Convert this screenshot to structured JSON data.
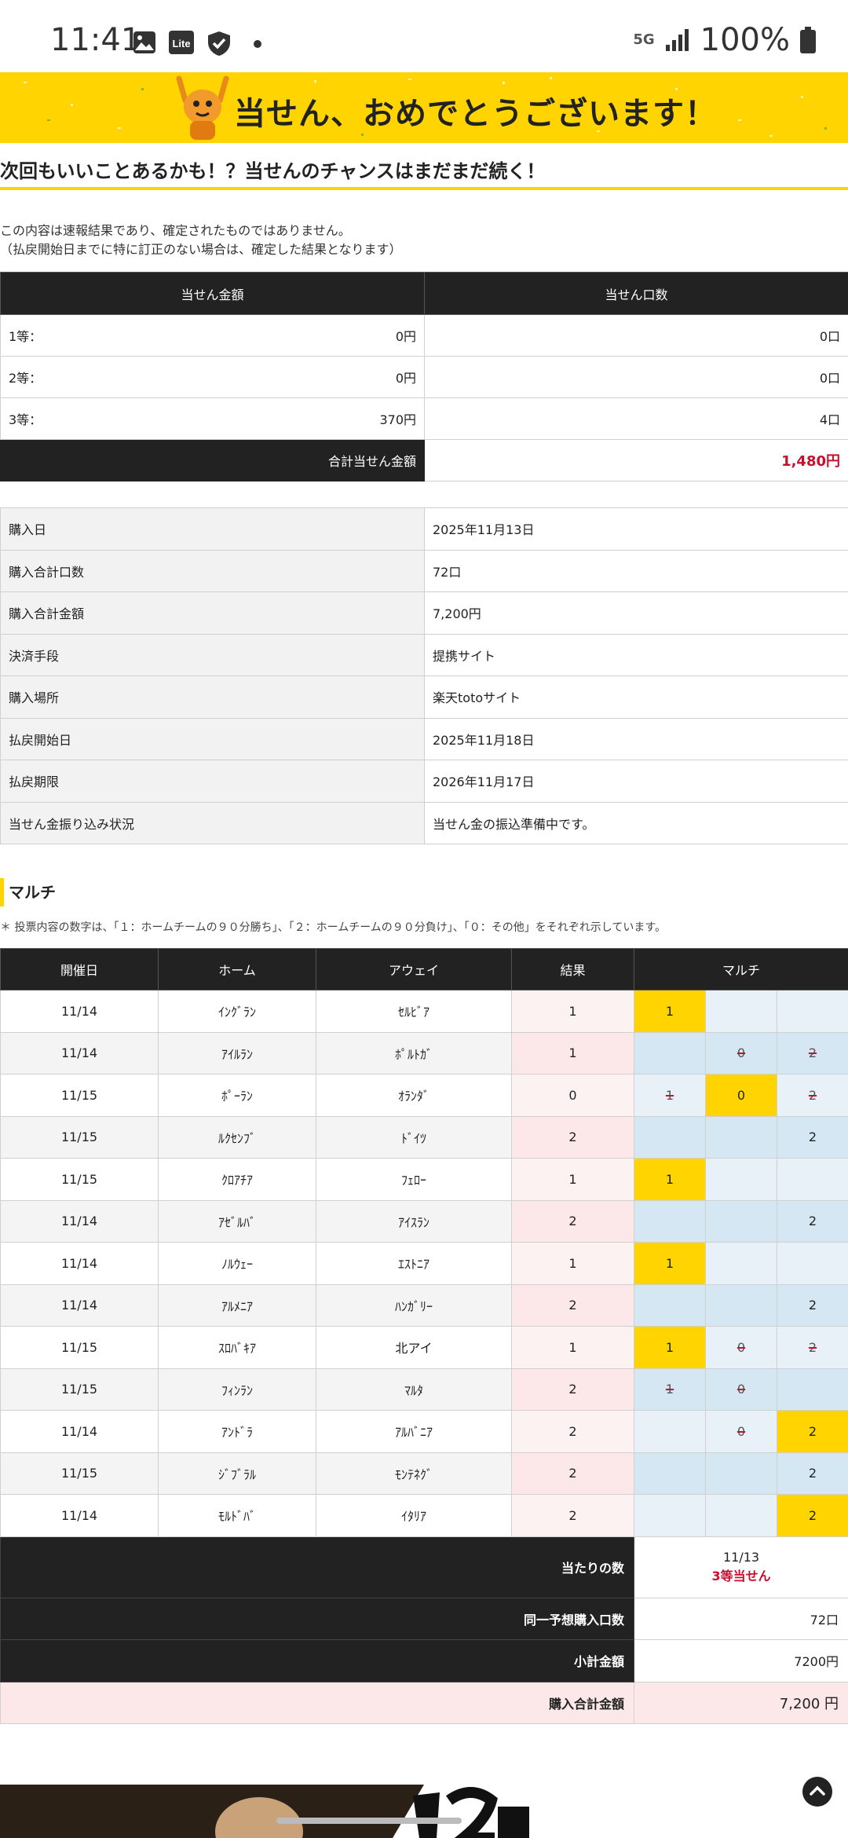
{
  "status_bar": {
    "time": "11:41",
    "network": "5G",
    "battery": "100%"
  },
  "banner": {
    "title": "当せん、おめでとうございます！"
  },
  "subhead": "次回もいいことあるかも！？当せんのチャンスはまだまだ続く！",
  "note": {
    "line1": "この内容は速報結果であり、確定されたものではありません。",
    "line2": "（払戻開始日までに特に訂正のない場合は、確定した結果となります）"
  },
  "prize": {
    "header_amount": "当せん金額",
    "header_count": "当せん口数",
    "rows": [
      {
        "label": "1等：",
        "amount": "0円",
        "count": "0口"
      },
      {
        "label": "2等：",
        "amount": "0円",
        "count": "0口"
      },
      {
        "label": "3等：",
        "amount": "370円",
        "count": "4口"
      }
    ],
    "total_label": "合計当せん金額",
    "total_value": "1,480円"
  },
  "info": [
    {
      "key": "購入日",
      "value": "2025年11月13日"
    },
    {
      "key": "購入合計口数",
      "value": "72口"
    },
    {
      "key": "購入合計金額",
      "value": "7,200円"
    },
    {
      "key": "決済手段",
      "value": "提携サイト"
    },
    {
      "key": "購入場所",
      "value": "楽天totoサイト"
    },
    {
      "key": "払戻開始日",
      "value": "2025年11月18日"
    },
    {
      "key": "払戻期限",
      "value": "2026年11月17日"
    },
    {
      "key": "当せん金振り込み状況",
      "value": "当せん金の振込準備中です。"
    }
  ],
  "section": {
    "title": "マルチ",
    "note": "＊ 投票内容の数字は、「１：ホームチームの９０分勝ち」、「２：ホームチームの９０分負け」、「０：その他」をそれぞれ示しています。"
  },
  "multi": {
    "headers": {
      "date": "開催日",
      "home": "ホーム",
      "away": "アウェイ",
      "result": "結果",
      "multi": "マルチ"
    },
    "rows": [
      {
        "date": "11/14",
        "home": "ｲﾝｸﾞﾗﾝ",
        "away": "ｾﾙﾋﾞｱ",
        "result": "1",
        "picks": [
          {
            "t": "1",
            "s": "hit"
          },
          {
            "t": "",
            "s": ""
          },
          {
            "t": "",
            "s": ""
          }
        ]
      },
      {
        "date": "11/14",
        "home": "ｱｲﾙﾗﾝ",
        "away": "ﾎﾟﾙﾄｶﾞ",
        "result": "1",
        "picks": [
          {
            "t": "",
            "s": ""
          },
          {
            "t": "0",
            "s": "x"
          },
          {
            "t": "2",
            "s": "x"
          }
        ]
      },
      {
        "date": "11/15",
        "home": "ﾎﾟｰﾗﾝ",
        "away": "ｵﾗﾝﾀﾞ",
        "result": "0",
        "picks": [
          {
            "t": "1",
            "s": "x"
          },
          {
            "t": "0",
            "s": "hit"
          },
          {
            "t": "2",
            "s": "x"
          }
        ]
      },
      {
        "date": "11/15",
        "home": "ﾙｸｾﾝﾌﾞ",
        "away": "ﾄﾞｲﾂ",
        "result": "2",
        "picks": [
          {
            "t": "",
            "s": ""
          },
          {
            "t": "",
            "s": ""
          },
          {
            "t": "2",
            "s": "hit"
          }
        ]
      },
      {
        "date": "11/15",
        "home": "ｸﾛｱﾁｱ",
        "away": "ﾌｪﾛｰ",
        "result": "1",
        "picks": [
          {
            "t": "1",
            "s": "hit"
          },
          {
            "t": "",
            "s": ""
          },
          {
            "t": "",
            "s": ""
          }
        ]
      },
      {
        "date": "11/14",
        "home": "ｱｾﾞﾙﾊﾞ",
        "away": "ｱｲｽﾗﾝ",
        "result": "2",
        "picks": [
          {
            "t": "",
            "s": ""
          },
          {
            "t": "",
            "s": ""
          },
          {
            "t": "2",
            "s": "hit"
          }
        ]
      },
      {
        "date": "11/14",
        "home": "ﾉﾙｳｪｰ",
        "away": "ｴｽﾄﾆｱ",
        "result": "1",
        "picks": [
          {
            "t": "1",
            "s": "hit"
          },
          {
            "t": "",
            "s": ""
          },
          {
            "t": "",
            "s": ""
          }
        ]
      },
      {
        "date": "11/14",
        "home": "ｱﾙﾒﾆｱ",
        "away": "ﾊﾝｶﾞﾘｰ",
        "result": "2",
        "picks": [
          {
            "t": "",
            "s": ""
          },
          {
            "t": "",
            "s": ""
          },
          {
            "t": "2",
            "s": "hit"
          }
        ]
      },
      {
        "date": "11/15",
        "home": "ｽﾛﾊﾞｷｱ",
        "away": "北アイ",
        "result": "1",
        "picks": [
          {
            "t": "1",
            "s": "hit"
          },
          {
            "t": "0",
            "s": "x"
          },
          {
            "t": "2",
            "s": "x"
          }
        ]
      },
      {
        "date": "11/15",
        "home": "ﾌｨﾝﾗﾝ",
        "away": "ﾏﾙﾀ",
        "result": "2",
        "picks": [
          {
            "t": "1",
            "s": "x"
          },
          {
            "t": "0",
            "s": "x"
          },
          {
            "t": "",
            "s": ""
          }
        ]
      },
      {
        "date": "11/14",
        "home": "ｱﾝﾄﾞﾗ",
        "away": "ｱﾙﾊﾞﾆｱ",
        "result": "2",
        "picks": [
          {
            "t": "",
            "s": ""
          },
          {
            "t": "0",
            "s": "x"
          },
          {
            "t": "2",
            "s": "hit"
          }
        ]
      },
      {
        "date": "11/15",
        "home": "ｼﾞﾌﾞﾗﾙ",
        "away": "ﾓﾝﾃﾈｸﾞ",
        "result": "2",
        "picks": [
          {
            "t": "",
            "s": ""
          },
          {
            "t": "",
            "s": ""
          },
          {
            "t": "2",
            "s": "hit"
          }
        ]
      },
      {
        "date": "11/14",
        "home": "ﾓﾙﾄﾞﾊﾞ",
        "away": "ｲﾀﾘｱ",
        "result": "2",
        "picks": [
          {
            "t": "",
            "s": ""
          },
          {
            "t": "",
            "s": ""
          },
          {
            "t": "2",
            "s": "hit"
          }
        ]
      }
    ],
    "summary": {
      "hits_label": "当たりの数",
      "hits_date": "11/13",
      "hits_result": "3等当せん",
      "same_label": "同一予想購入口数",
      "same_value": "72口",
      "subtotal_label": "小計金額",
      "subtotal_value": "7200円",
      "grand_label": "購入合計金額",
      "grand_value": "7,200 円"
    }
  },
  "colors": {
    "accent": "#ffd400",
    "win_red": "#c8102e",
    "header_dark": "#222222",
    "pick_blue": "#e8f1f8"
  }
}
